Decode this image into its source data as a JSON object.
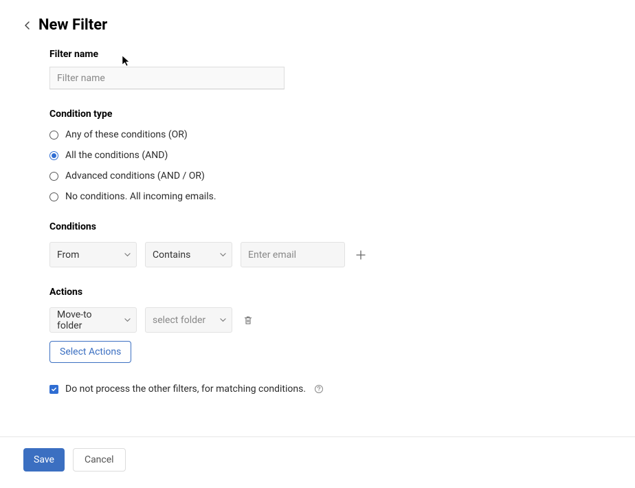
{
  "header": {
    "title": "New Filter"
  },
  "sections": {
    "filter_name_label": "Filter name",
    "filter_name_placeholder": "Filter name",
    "condition_type_label": "Condition type",
    "conditions_label": "Conditions",
    "actions_label": "Actions"
  },
  "condition_type": {
    "options": [
      {
        "label": "Any of these conditions (OR)",
        "checked": false
      },
      {
        "label": "All the conditions (AND)",
        "checked": true
      },
      {
        "label": "Advanced conditions (AND / OR)",
        "checked": false
      },
      {
        "label": "No conditions. All incoming emails.",
        "checked": false
      }
    ]
  },
  "condition_row": {
    "field": "From",
    "operator": "Contains",
    "value_placeholder": "Enter email"
  },
  "action_row": {
    "action": "Move-to folder",
    "target": "select folder"
  },
  "buttons": {
    "select_actions": "Select Actions",
    "save": "Save",
    "cancel": "Cancel"
  },
  "checkbox": {
    "label": "Do not process the other filters, for matching conditions.",
    "checked": true
  }
}
